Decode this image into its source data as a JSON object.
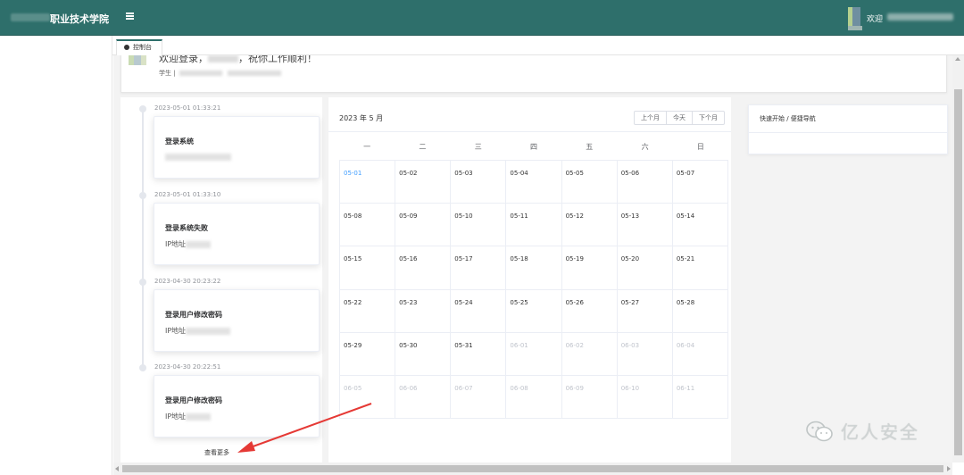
{
  "header": {
    "brand_label": "职业技术学院",
    "welcome_label": "欢迎",
    "accent_color": "#2e6f6b"
  },
  "tabs": [
    {
      "label": "控制台",
      "icon": "dashboard-icon"
    }
  ],
  "welcome_card": {
    "title_prefix": "欢迎登录，",
    "title_suffix": "，祝你工作顺利！",
    "role_label": "学生 |"
  },
  "timeline": {
    "items": [
      {
        "time": "2023-05-01 01:33:21",
        "title": "登录系统",
        "detail": ""
      },
      {
        "time": "2023-05-01 01:33:10",
        "title": "登录系统失败",
        "detail": "IP地址"
      },
      {
        "time": "2023-04-30 20:23:22",
        "title": "登录用户修改密码",
        "detail": "IP地址"
      },
      {
        "time": "2023-04-30 20:22:51",
        "title": "登录用户修改密码",
        "detail": "IP地址"
      }
    ],
    "view_more_label": "查看更多"
  },
  "calendar": {
    "title": "2023 年 5 月",
    "prev_label": "上个月",
    "today_label": "今天",
    "next_label": "下个月",
    "weekdays": [
      "一",
      "二",
      "三",
      "四",
      "五",
      "六",
      "日"
    ],
    "cells": [
      {
        "d": "05-01",
        "s": "today"
      },
      {
        "d": "05-02",
        "s": ""
      },
      {
        "d": "05-03",
        "s": ""
      },
      {
        "d": "05-04",
        "s": ""
      },
      {
        "d": "05-05",
        "s": ""
      },
      {
        "d": "05-06",
        "s": ""
      },
      {
        "d": "05-07",
        "s": ""
      },
      {
        "d": "05-08",
        "s": ""
      },
      {
        "d": "05-09",
        "s": ""
      },
      {
        "d": "05-10",
        "s": ""
      },
      {
        "d": "05-11",
        "s": ""
      },
      {
        "d": "05-12",
        "s": ""
      },
      {
        "d": "05-13",
        "s": ""
      },
      {
        "d": "05-14",
        "s": ""
      },
      {
        "d": "05-15",
        "s": ""
      },
      {
        "d": "05-16",
        "s": ""
      },
      {
        "d": "05-17",
        "s": ""
      },
      {
        "d": "05-18",
        "s": ""
      },
      {
        "d": "05-19",
        "s": ""
      },
      {
        "d": "05-20",
        "s": ""
      },
      {
        "d": "05-21",
        "s": ""
      },
      {
        "d": "05-22",
        "s": ""
      },
      {
        "d": "05-23",
        "s": ""
      },
      {
        "d": "05-24",
        "s": ""
      },
      {
        "d": "05-25",
        "s": ""
      },
      {
        "d": "05-26",
        "s": ""
      },
      {
        "d": "05-27",
        "s": ""
      },
      {
        "d": "05-28",
        "s": ""
      },
      {
        "d": "05-29",
        "s": ""
      },
      {
        "d": "05-30",
        "s": ""
      },
      {
        "d": "05-31",
        "s": ""
      },
      {
        "d": "06-01",
        "s": "other"
      },
      {
        "d": "06-02",
        "s": "other"
      },
      {
        "d": "06-03",
        "s": "other"
      },
      {
        "d": "06-04",
        "s": "other"
      },
      {
        "d": "06-05",
        "s": "other"
      },
      {
        "d": "06-06",
        "s": "other"
      },
      {
        "d": "06-07",
        "s": "other"
      },
      {
        "d": "06-08",
        "s": "other"
      },
      {
        "d": "06-09",
        "s": "other"
      },
      {
        "d": "06-10",
        "s": "other"
      },
      {
        "d": "06-11",
        "s": "other"
      }
    ],
    "today_color": "#409eff",
    "other_month_color": "#c0c4cc"
  },
  "quicknav": {
    "title": "快速开始 / 便捷导航"
  },
  "annotation": {
    "arrow_color": "#e53935"
  },
  "watermark": {
    "text": "亿人安全",
    "icon": "wechat-icon"
  }
}
